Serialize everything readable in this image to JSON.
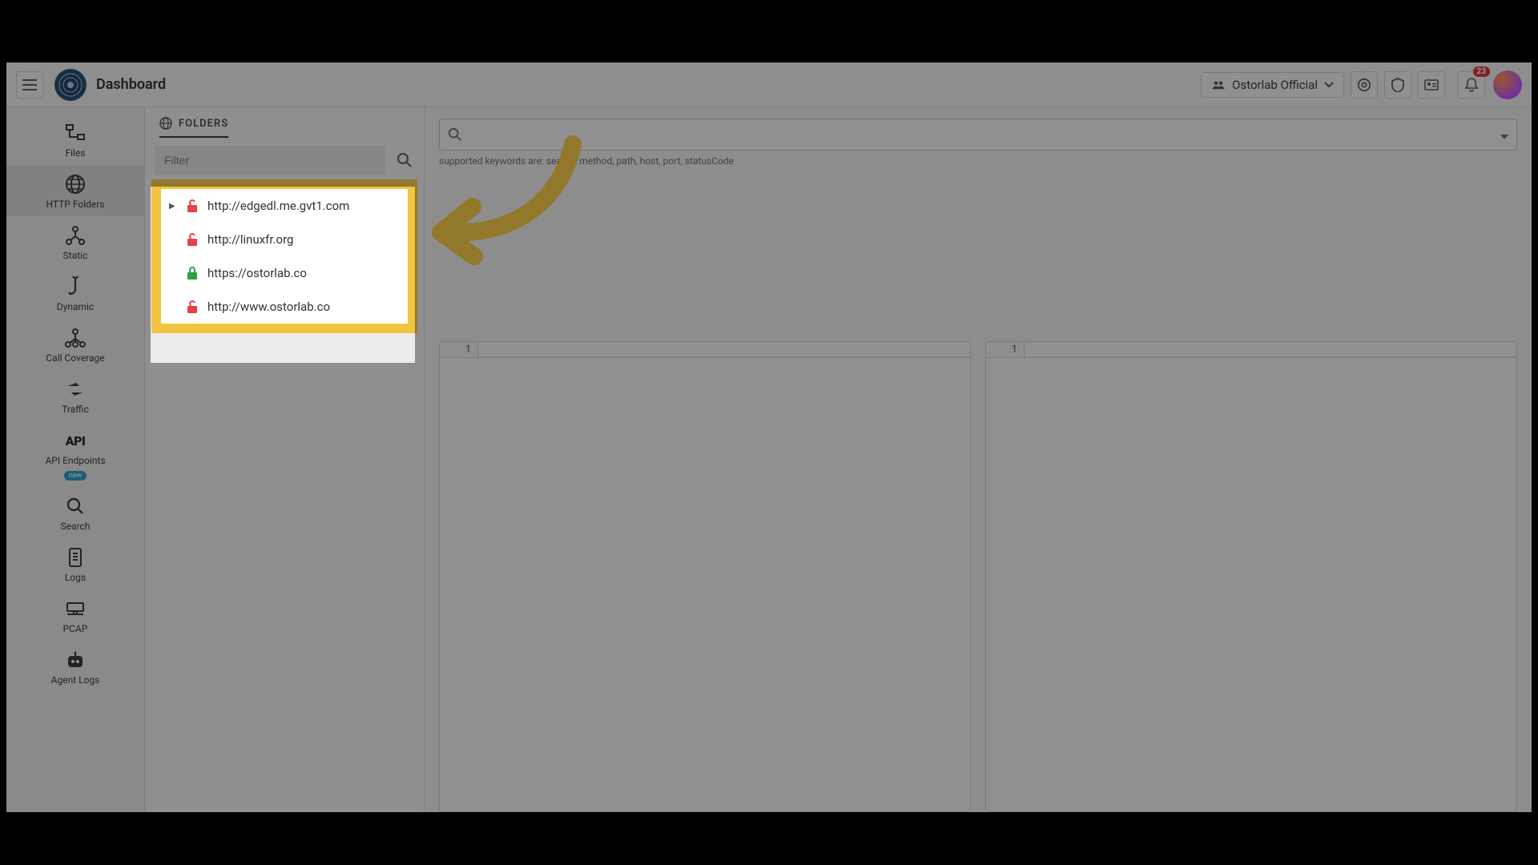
{
  "header": {
    "title": "Dashboard",
    "org_label": "Ostorlab Official",
    "notif_count": "23"
  },
  "left_nav": {
    "items": [
      {
        "label": "Files"
      },
      {
        "label": "HTTP Folders"
      },
      {
        "label": "Static"
      },
      {
        "label": "Dynamic"
      },
      {
        "label": "Call Coverage"
      },
      {
        "label": "Traffic"
      },
      {
        "label": "API Endpoints",
        "badge": "new"
      },
      {
        "label": "Search"
      },
      {
        "label": "Logs"
      },
      {
        "label": "PCAP"
      },
      {
        "label": "Agent Logs"
      }
    ]
  },
  "folders": {
    "tab_label": "FOLDERS",
    "filter_placeholder": "Filter",
    "items": [
      {
        "url": "http://edgedl.me.gvt1.com",
        "secure": false,
        "expandable": true
      },
      {
        "url": "http://linuxfr.org",
        "secure": false,
        "expandable": false
      },
      {
        "url": "https://ostorlab.co",
        "secure": true,
        "expandable": false
      },
      {
        "url": "http://www.ostorlab.co",
        "secure": false,
        "expandable": false
      }
    ]
  },
  "main": {
    "search_hint": "supported keywords are: search, method, path, host, port, statusCode",
    "left_pane_line": "1",
    "right_pane_line": "1"
  }
}
